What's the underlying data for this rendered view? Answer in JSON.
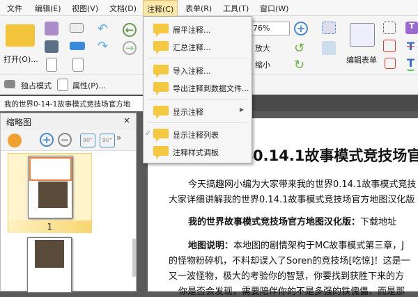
{
  "menubar": {
    "items": [
      "文件",
      "编辑(E)",
      "视图(V)",
      "文档(D)",
      "注释(C)",
      "表单(R)",
      "工具(T)",
      "窗口(W)"
    ]
  },
  "toolbar": {
    "open_label": "打开(O)...",
    "zoom_value": "76%",
    "zoom_in_label": "放大",
    "zoom_out_label": "缩小",
    "edit_form_label": "编辑表单",
    "exclusive_mode_label": "独占模式",
    "properties_label": "属性(P)..."
  },
  "document_tab": {
    "title": "我的世界0-14-1故事模式竞技场官方地"
  },
  "thumbnail_panel": {
    "title": "缩略图",
    "close": "×",
    "page_labels": [
      "1"
    ]
  },
  "annotation_menu": {
    "items": [
      {
        "label": "展平注释..."
      },
      {
        "label": "汇总注释..."
      },
      {
        "label": "导入注释..."
      },
      {
        "label": "导出注释到数据文件..."
      },
      {
        "label": "显示注释"
      },
      {
        "label": "显示注释列表",
        "checked": true
      },
      {
        "label": "注释样式调板"
      }
    ]
  },
  "document": {
    "heading": "界0.14.1故事模式竞技场官",
    "lines": [
      "今天搞趣网小编为大家带来我的世界0.14.1故事模式竞技",
      "大家详细讲解我的世界0.14.1故事模式竞技场官方地图汉化版"
    ],
    "download_label": "我的世界故事模式竞技场官方地图汉化版：",
    "download_link": "下载地址",
    "desc_label": "地图说明：",
    "desc_lines": [
      "本地图的剧情架构于MC故事模式第三章，J",
      "的怪物粉碎机，不料却误入了Soren的竞技场[吃惊]！这是一",
      "又一波怪物，极大的考验你的智慧，你要找到获胜下来的方",
      "你是否会发现，需要陪伴你的不是多强的铁傀儡，而是那"
    ]
  }
}
